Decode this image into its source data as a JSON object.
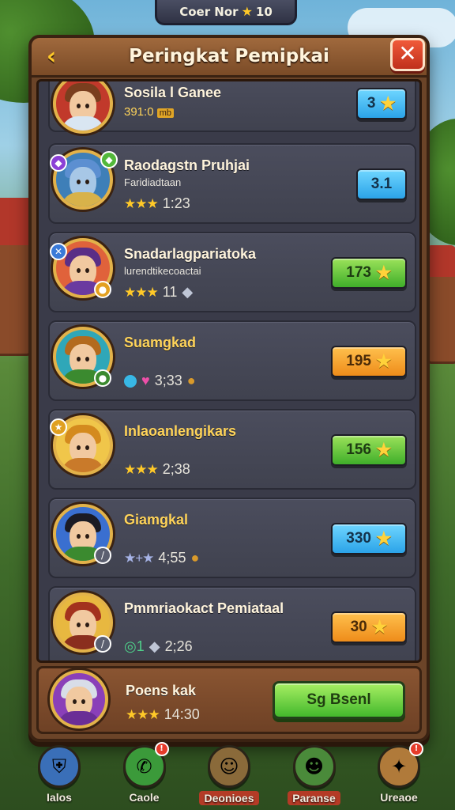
{
  "top_bar": {
    "text": "Coer Nor",
    "value": "10"
  },
  "panel": {
    "title": "Peringkat Pemipkai",
    "back_icon": "chevron-left-icon",
    "close_icon": "close-icon"
  },
  "rows": [
    {
      "name": "Sosila l Ganee",
      "subtitle": "391:0",
      "tag": "mb",
      "stats": "",
      "score": "3",
      "score_color": "blue"
    },
    {
      "name": "Raodagstn Pruhjai",
      "subtitle": "Faridiadtaan",
      "stars": "★★★",
      "stats": "1:23",
      "score": "3.1",
      "score_color": "blue"
    },
    {
      "name": "Snadarlagpariatoka",
      "subtitle": "lurendtikecoactai",
      "stars": "★★★",
      "stats": "11",
      "score": "173",
      "score_color": "green"
    },
    {
      "name": "Suamgkad",
      "subtitle": "",
      "stars": "",
      "stats": "3;33",
      "score": "195",
      "score_color": "orange"
    },
    {
      "name": "Inlaoanlengikars",
      "subtitle": "",
      "stars": "★★★",
      "stats": "2;38",
      "score": "156",
      "score_color": "green"
    },
    {
      "name": "Giamgkal",
      "subtitle": "",
      "stars": "★+★",
      "stats": "4;55",
      "score": "330",
      "score_color": "blue"
    },
    {
      "name": "Pmmriaokact Pemiataal",
      "subtitle": "",
      "stars": "◎1",
      "stats": "2;26",
      "score": "30",
      "score_color": "orange"
    }
  ],
  "me": {
    "name": "Poens kak",
    "stars": "★★★",
    "stats": "14:30",
    "button": "Sg Bsenl"
  },
  "nav": [
    {
      "label": "Ialos",
      "icon": "shield-icon",
      "badge": ""
    },
    {
      "label": "Caole",
      "icon": "phone-icon",
      "badge": "!"
    },
    {
      "label": "Deonioes",
      "icon": "hero-icon",
      "badge": ""
    },
    {
      "label": "Paranse",
      "icon": "goblin-icon",
      "badge": ""
    },
    {
      "label": "Ureaoe",
      "icon": "compass-icon",
      "badge": "!"
    }
  ],
  "colors": {
    "panel": "#6b4428",
    "list_bg": "#3a3b49",
    "gold": "#ffc928"
  }
}
